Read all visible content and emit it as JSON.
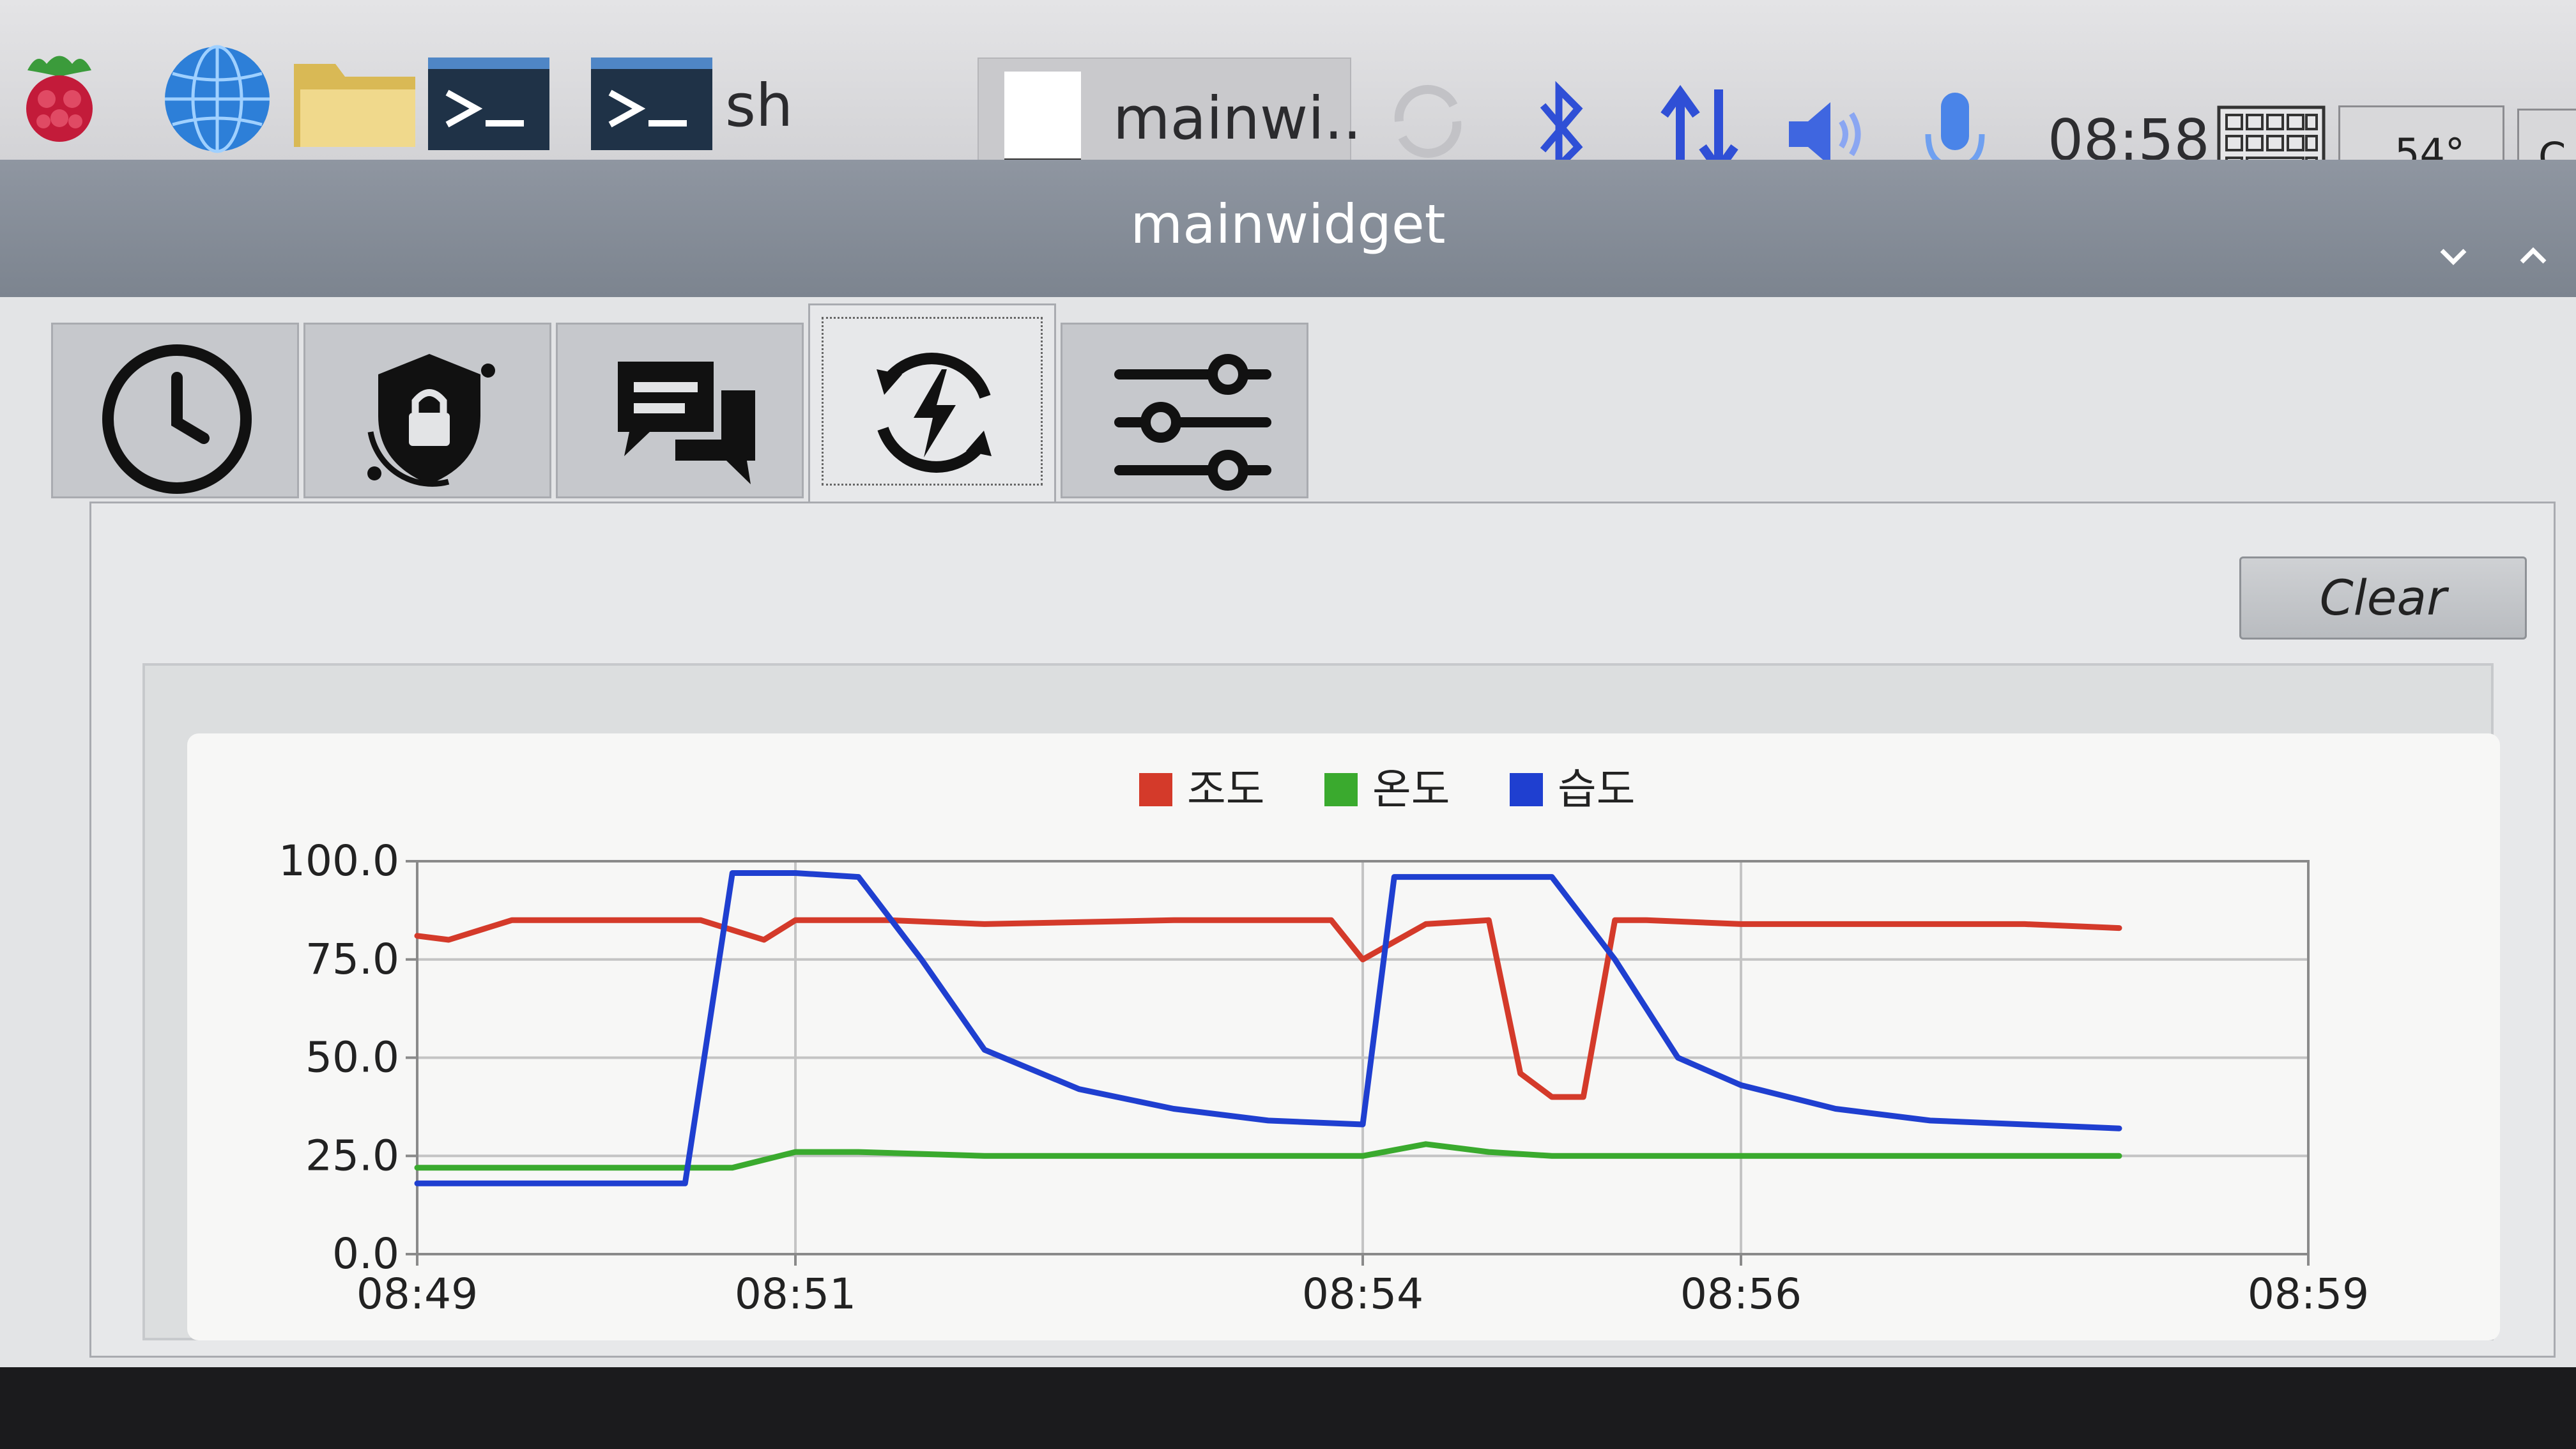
{
  "taskbar": {
    "terminal_label": "sh",
    "app_button_label": "mainwi..",
    "clock": "08:58",
    "temperature": "54°",
    "partial_button": "C",
    "icons": [
      "raspberry-menu-icon",
      "web-browser-icon",
      "file-manager-icon",
      "terminal-icon",
      "terminal-icon",
      "app-document-icon",
      "sync-icon",
      "bluetooth-icon",
      "network-icon",
      "volume-icon",
      "microphone-icon",
      "keyboard-icon"
    ]
  },
  "window": {
    "title": "mainwidget",
    "tabs": [
      {
        "icon": "clock-icon"
      },
      {
        "icon": "shield-lock-icon"
      },
      {
        "icon": "chat-icon"
      },
      {
        "icon": "power-cycle-icon"
      },
      {
        "icon": "sliders-icon"
      }
    ],
    "active_tab": 3,
    "clear_button": "Clear"
  },
  "colors": {
    "illuminance": "#d43a2a",
    "temperature": "#3aaa2e",
    "humidity": "#1f3fd0",
    "grid": "#c4c4c4",
    "axis": "#8a8a8a"
  },
  "chart_data": {
    "type": "line",
    "title": "",
    "xlabel": "",
    "ylabel": "",
    "ylim": [
      0,
      100
    ],
    "yticks": [
      "0.0",
      "25.0",
      "50.0",
      "75.0",
      "100.0"
    ],
    "xticks": [
      "08:49",
      "08:51",
      "08:54",
      "08:56",
      "08:59"
    ],
    "xlim": [
      "08:49",
      "08:59"
    ],
    "legend_position": "top-center",
    "grid": true,
    "series": [
      {
        "name": "조도",
        "color": "#d43a2a",
        "x": [
          "08:49:00",
          "08:49:10",
          "08:49:30",
          "08:50:00",
          "08:50:30",
          "08:50:50",
          "08:51:00",
          "08:51:30",
          "08:52:00",
          "08:53:00",
          "08:53:30",
          "08:53:50",
          "08:54:00",
          "08:54:20",
          "08:54:40",
          "08:54:50",
          "08:55:00",
          "08:55:10",
          "08:55:20",
          "08:55:30",
          "08:56:00",
          "08:56:30",
          "08:57:00",
          "08:57:30",
          "08:58:00"
        ],
        "y": [
          81,
          80,
          85,
          85,
          85,
          80,
          85,
          85,
          84,
          85,
          85,
          85,
          75,
          84,
          85,
          46,
          40,
          40,
          85,
          85,
          84,
          84,
          84,
          84,
          83
        ]
      },
      {
        "name": "온도",
        "color": "#3aaa2e",
        "x": [
          "08:49:00",
          "08:50:00",
          "08:50:40",
          "08:51:00",
          "08:51:20",
          "08:52:00",
          "08:53:00",
          "08:54:00",
          "08:54:20",
          "08:54:40",
          "08:55:00",
          "08:56:00",
          "08:57:00",
          "08:58:00"
        ],
        "y": [
          22,
          22,
          22,
          26,
          26,
          25,
          25,
          25,
          28,
          26,
          25,
          25,
          25,
          25
        ]
      },
      {
        "name": "습도",
        "color": "#1f3fd0",
        "x": [
          "08:49:00",
          "08:50:25",
          "08:50:40",
          "08:51:00",
          "08:51:20",
          "08:51:40",
          "08:52:00",
          "08:52:30",
          "08:53:00",
          "08:53:30",
          "08:54:00",
          "08:54:10",
          "08:54:20",
          "08:55:00",
          "08:55:20",
          "08:55:40",
          "08:56:00",
          "08:56:30",
          "08:57:00",
          "08:57:30",
          "08:58:00"
        ],
        "y": [
          18,
          18,
          97,
          97,
          96,
          75,
          52,
          42,
          37,
          34,
          33,
          96,
          96,
          96,
          75,
          50,
          43,
          37,
          34,
          33,
          32
        ]
      }
    ]
  }
}
